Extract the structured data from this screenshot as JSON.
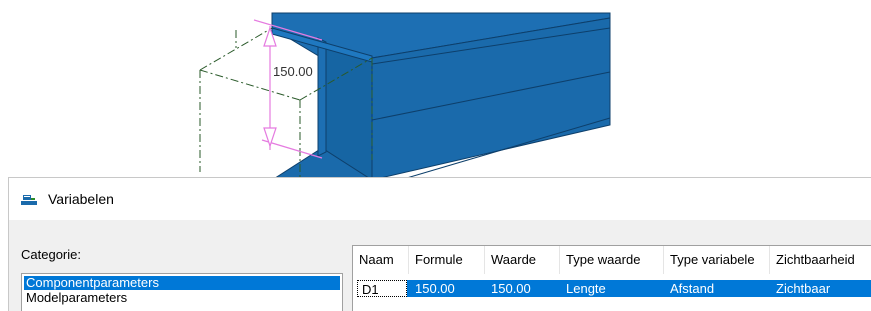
{
  "viewport": {
    "dimension_value": "150.00",
    "colors": {
      "steel": "#1a6aab",
      "steel_edge": "#0d3f6b",
      "dimension_line": "#e57be0",
      "construction_line": "#2a5a2a"
    }
  },
  "dialog": {
    "title": "Variabelen",
    "icon": "variables-icon",
    "category_label": "Categorie:",
    "categories": [
      {
        "label": "Componentparameters",
        "selected": true
      },
      {
        "label": "Modelparameters",
        "selected": false
      }
    ],
    "table": {
      "columns": [
        "Naam",
        "Formule",
        "Waarde",
        "Type waarde",
        "Type variabele",
        "Zichtbaarheid"
      ],
      "rows": [
        {
          "naam": "D1",
          "formule": "150.00",
          "waarde": "150.00",
          "type_waarde": "Lengte",
          "type_variabele": "Afstand",
          "zichtbaarheid": "Zichtbaar"
        }
      ]
    },
    "selection_color": "#0078d7"
  }
}
